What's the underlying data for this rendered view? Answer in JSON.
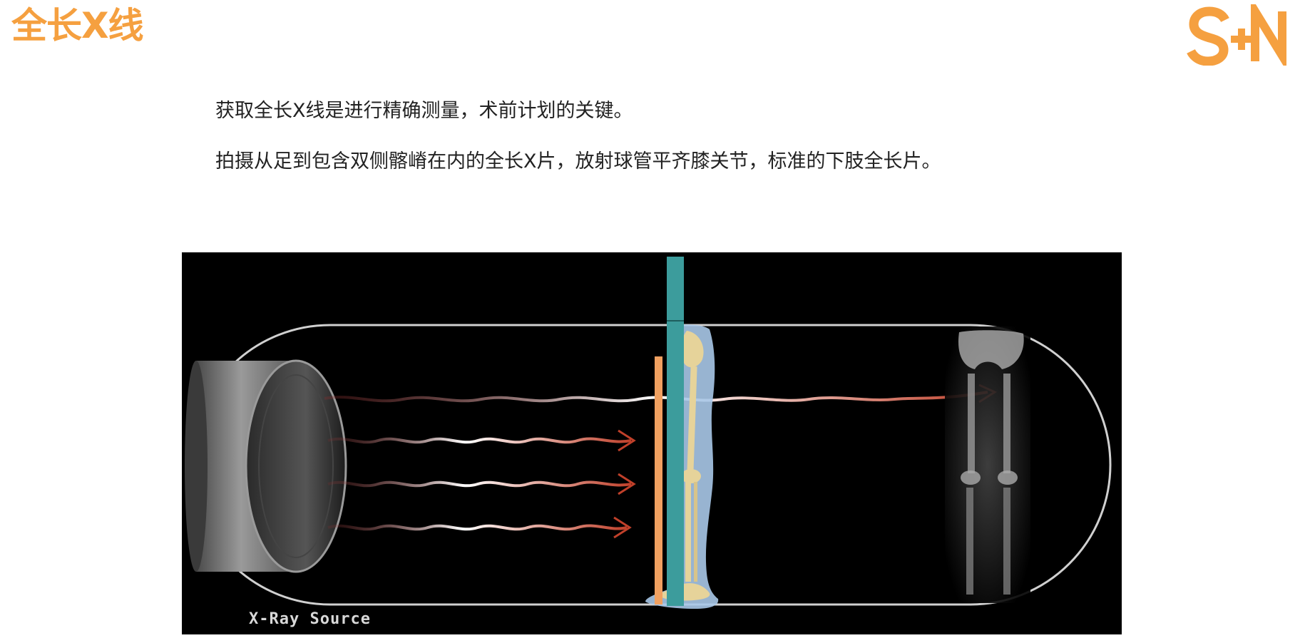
{
  "slide": {
    "title": "全长X线",
    "logo_text": "S+N",
    "paragraphs": [
      "获取全长X线是进行精确测量，术前计划的关键。",
      "拍摄从足到包含双侧髂嵴在内的全长X片，放射球管平齐膝关节，标准的下肢全长片。"
    ]
  },
  "figure": {
    "caption": "X-Ray Source",
    "icons": [
      "xray-source-cylinder",
      "leg-skeleton-model",
      "xray-film-image"
    ]
  },
  "colors": {
    "accent": "#f5a040",
    "text": "#222222",
    "figure_bg": "#000000",
    "detector_teal": "#3c9c9c",
    "marker_orange": "#f0a060"
  }
}
